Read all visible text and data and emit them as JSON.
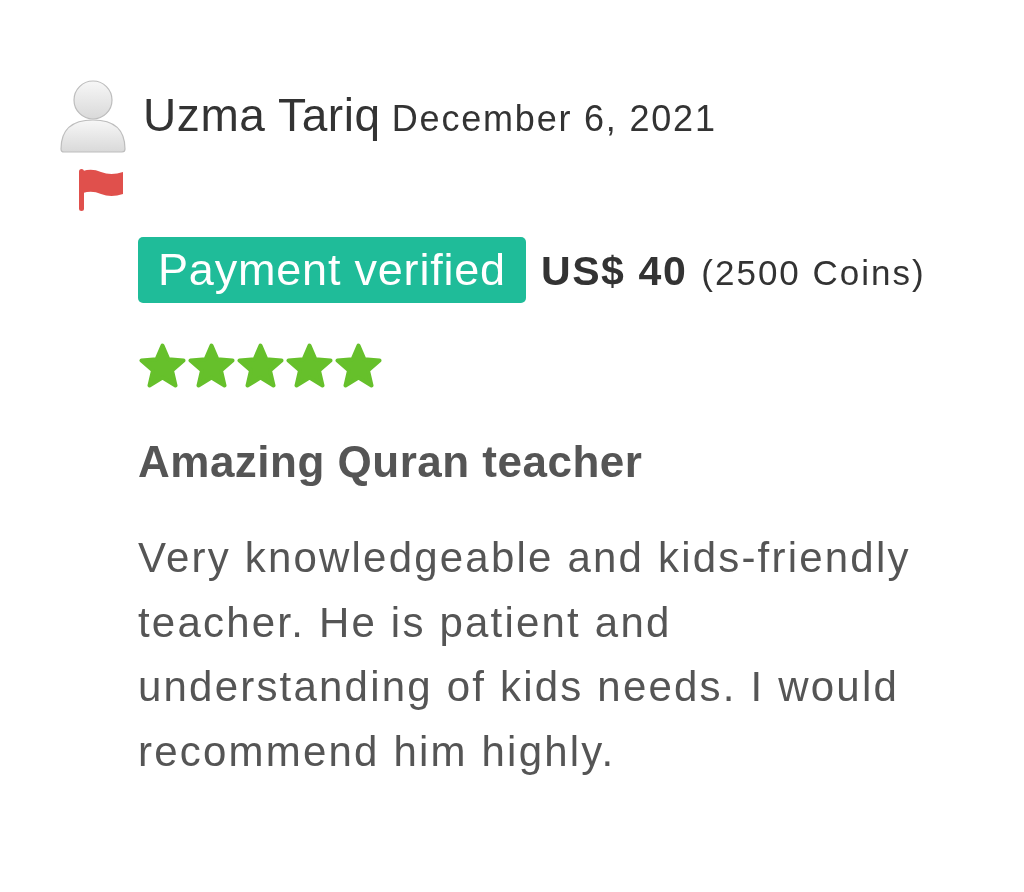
{
  "review": {
    "reviewer": "Uzma Tariq",
    "date": "December 6, 2021",
    "badge": "Payment verified",
    "amount": "US$ 40",
    "coins": "(2500 Coins)",
    "stars": 5,
    "title": "Amazing Quran teacher",
    "body": "Very knowledgeable and kids-friendly teacher. He is patient and understanding of kids needs. I would recommend him highly."
  }
}
